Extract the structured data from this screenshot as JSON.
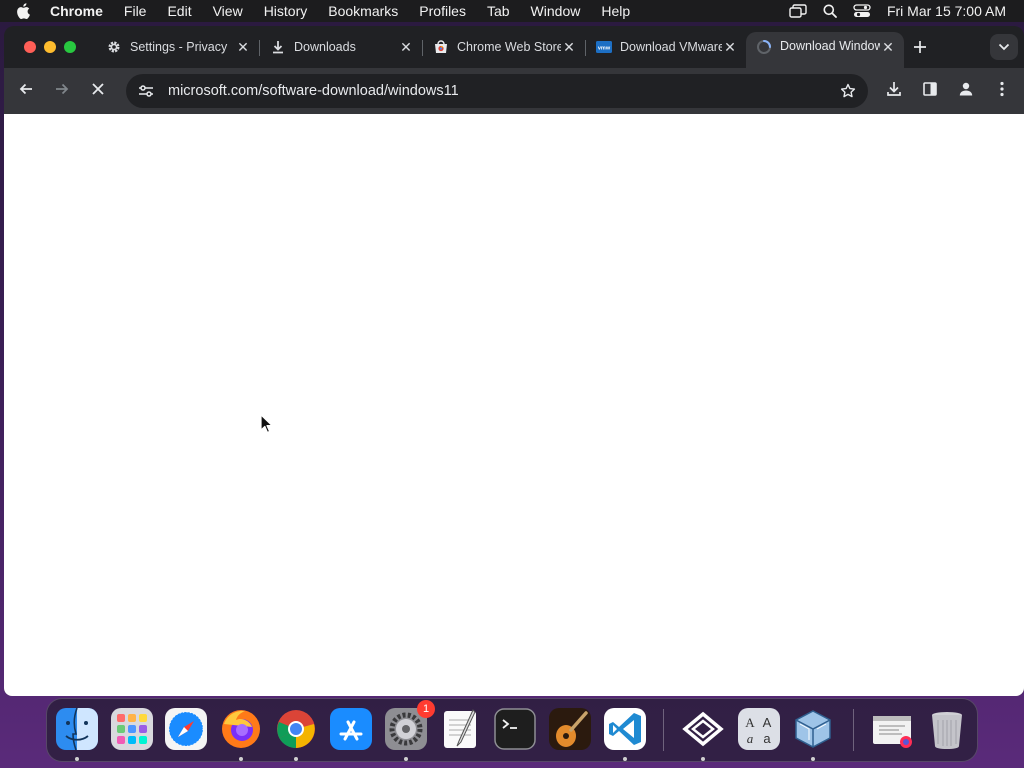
{
  "menubar": {
    "app_name": "Chrome",
    "items": [
      "File",
      "Edit",
      "View",
      "History",
      "Bookmarks",
      "Profiles",
      "Tab",
      "Window",
      "Help"
    ],
    "clock": "Fri Mar 15  7:00 AM"
  },
  "browser": {
    "tabs": [
      {
        "title": "Settings - Privacy",
        "icon": "gear-icon",
        "active": false
      },
      {
        "title": "Downloads",
        "icon": "download-icon",
        "active": false
      },
      {
        "title": "Chrome Web Store",
        "icon": "web-store-icon",
        "active": false
      },
      {
        "title": "Download VMware",
        "icon": "vmware-icon",
        "active": false
      },
      {
        "title": "Download Windows",
        "icon": "loading-spinner-icon",
        "active": true
      }
    ],
    "url": "microsoft.com/software-download/windows11",
    "loading": true
  },
  "dock": {
    "apps": [
      {
        "name": "Finder",
        "running": true
      },
      {
        "name": "Launchpad",
        "running": false
      },
      {
        "name": "Safari",
        "running": false
      },
      {
        "name": "Firefox",
        "running": true
      },
      {
        "name": "Google Chrome",
        "running": true
      },
      {
        "name": "App Store",
        "running": false
      },
      {
        "name": "System Settings",
        "running": true,
        "badge": "1"
      },
      {
        "name": "TextEdit",
        "running": false
      },
      {
        "name": "Terminal",
        "running": false
      },
      {
        "name": "GarageBand",
        "running": false
      },
      {
        "name": "Visual Studio Code",
        "running": true
      },
      {
        "name": "Parallels",
        "running": true
      },
      {
        "name": "Font Book",
        "running": false
      },
      {
        "name": "VirtualBox",
        "running": true
      },
      {
        "name": "Downloads Stack",
        "running": false
      },
      {
        "name": "Trash",
        "running": false
      }
    ]
  },
  "colors": {
    "menubar_bg": "#1c1c1e",
    "chrome_frame": "#202124",
    "chrome_toolbar": "#35363a",
    "page_bg": "#ffffff"
  }
}
